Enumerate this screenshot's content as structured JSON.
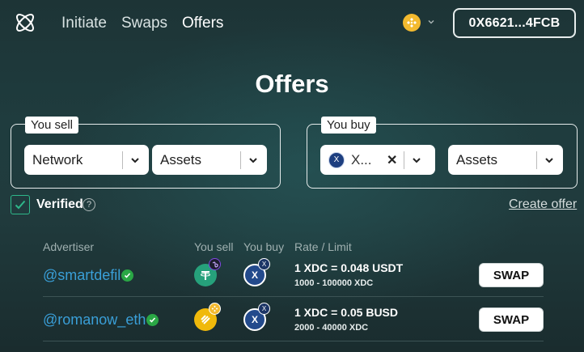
{
  "header": {
    "nav": [
      "Initiate",
      "Swaps",
      "Offers"
    ],
    "active_nav": "Offers",
    "wallet_address": "0X6621...4FCB",
    "network_icon": "bnb-coin-icon"
  },
  "page_title": "Offers",
  "sell_filter": {
    "label": "You sell",
    "network_value": "Network",
    "assets_value": "Assets"
  },
  "buy_filter": {
    "label": "You buy",
    "selected_network": "X...",
    "assets_value": "Assets"
  },
  "verified": {
    "label": "Verified",
    "checked": true,
    "help_glyph": "?"
  },
  "create_offer_label": "Create offer",
  "table": {
    "headers": {
      "advertiser": "Advertiser",
      "you_sell": "You sell",
      "you_buy": "You buy",
      "rate_limit": "Rate / Limit"
    },
    "rows": [
      {
        "advertiser": "@smartdefil",
        "sell_token_icon": "usdt-icon",
        "sell_chain_icon": "polygon-icon",
        "buy_token_icon": "xdc-icon",
        "buy_chain_icon": "xdc-icon",
        "rate": "1 XDC = 0.048 USDT",
        "limit": "1000 - 100000 XDC",
        "action": "SWAP"
      },
      {
        "advertiser": "@romanow_eth",
        "sell_token_icon": "busd-icon",
        "sell_chain_icon": "bnb-icon",
        "buy_token_icon": "xdc-icon",
        "buy_chain_icon": "xdc-icon",
        "rate": "1 XDC = 0.05 BUSD",
        "limit": "2000 - 40000 XDC",
        "action": "SWAP"
      }
    ]
  },
  "colors": {
    "link": "#3a9fd8",
    "verified_green": "#2aa745",
    "checkbox_border": "#2eb88a"
  }
}
